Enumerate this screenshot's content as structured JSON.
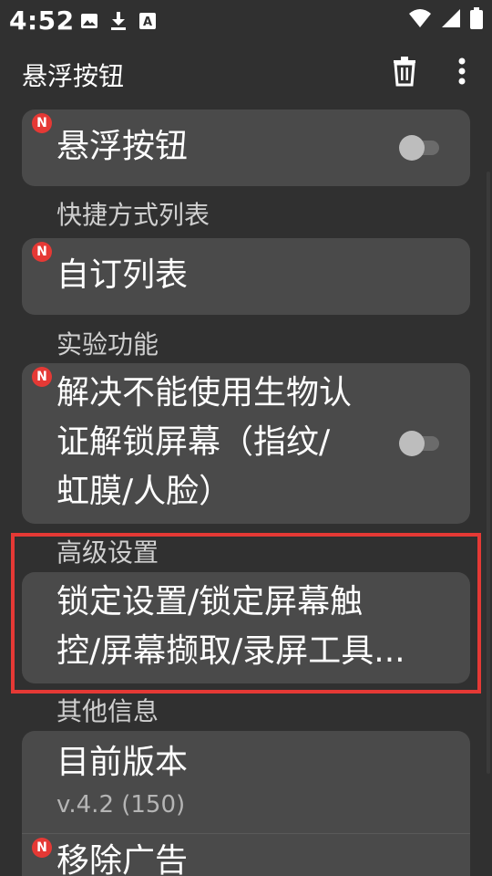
{
  "status_bar": {
    "time": "4:52",
    "left_icons": [
      "image-icon",
      "download-icon",
      "a-icon"
    ],
    "right_icons": [
      "wifi-icon",
      "signal-icon",
      "battery-icon"
    ]
  },
  "app_bar": {
    "title": "悬浮按钮",
    "actions": [
      "trash-icon",
      "more-vert-icon"
    ]
  },
  "badge_text": "N",
  "items": {
    "floating_button": {
      "label": "悬浮按钮",
      "toggle_on": false,
      "badge": true
    },
    "shortcut_header": "快捷方式列表",
    "custom_list": {
      "label": "自订列表",
      "badge": true
    },
    "experimental_header": "实验功能",
    "biometric": {
      "lines": [
        "解决不能使用生物认",
        "证解锁屏幕（指纹/",
        "虹膜/人脸）"
      ],
      "toggle_on": false,
      "badge": true
    },
    "advanced_header": "高级设置",
    "lock_settings": {
      "lines": [
        "锁定设置/锁定屏幕触",
        "控/屏幕撷取/录屏工具..."
      ]
    },
    "other_header": "其他信息",
    "version": {
      "label": "目前版本",
      "value": "v.4.2 (150)"
    },
    "remove_ads": {
      "label": "移除广告",
      "badge": true
    }
  },
  "colors": {
    "background": "#303030",
    "card": "#4a4a4a",
    "badge": "#e53935",
    "highlight": "#e53935"
  }
}
